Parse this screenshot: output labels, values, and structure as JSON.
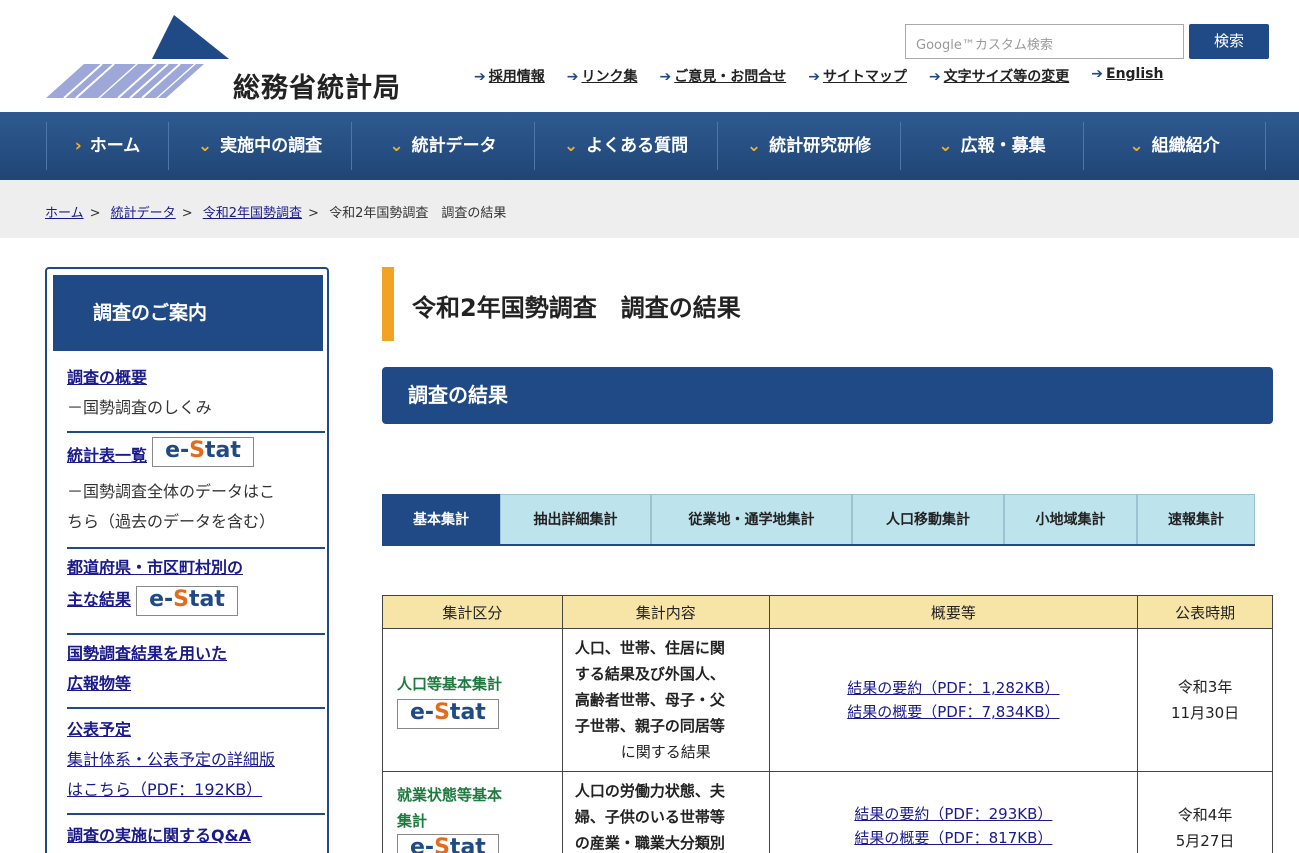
{
  "header": {
    "site_title": "総務省統計局",
    "search_placeholder": "Google™カスタム検索",
    "search_button": "検索",
    "util_links": [
      {
        "label": "採用情報"
      },
      {
        "label": "リンク集"
      },
      {
        "label": "ご意見・お問合せ"
      },
      {
        "label": "サイトマップ"
      },
      {
        "label": "文字サイズ等の変更"
      },
      {
        "label": "English"
      }
    ]
  },
  "gnav": {
    "items": [
      {
        "label": "ホーム"
      },
      {
        "label": "実施中の調査"
      },
      {
        "label": "統計データ"
      },
      {
        "label": "よくある質問"
      },
      {
        "label": "統計研究研修"
      },
      {
        "label": "広報・募集"
      },
      {
        "label": "組織紹介"
      }
    ]
  },
  "breadcrumb": {
    "items": [
      "ホーム",
      "統計データ",
      "令和2年国勢調査"
    ],
    "current": "令和2年国勢調査　調査の結果"
  },
  "sidebar": {
    "heading": "調査のご案内",
    "items": [
      {
        "title": "調査の概要",
        "desc": "－国勢調査のしくみ"
      },
      {
        "title": "統計表一覧",
        "desc1": "－国勢調査全体のデータはこ",
        "desc2": "ちら（過去のデータを含む）"
      },
      {
        "title1": "都道府県・市区町村別の",
        "title2": "主な結果"
      },
      {
        "title1": "国勢調査結果を用いた",
        "title2": "広報物等"
      },
      {
        "title": "公表予定",
        "desc1": "集計体系・公表予定の詳細版",
        "desc2": "はこちら（PDF：192KB）"
      },
      {
        "title": "調査の実施に関するQ&A"
      }
    ],
    "estat_prefix": "e-",
    "estat_suffix": "tat",
    "estat_s": "S"
  },
  "main": {
    "page_title": "令和2年国勢調査　調査の結果",
    "section_title": "調査の結果",
    "tabs": [
      {
        "label": "基本集計"
      },
      {
        "label": "抽出詳細集計"
      },
      {
        "label": "従業地・通学地集計"
      },
      {
        "label": "人口移動集計"
      },
      {
        "label": "小地域集計"
      },
      {
        "label": "速報集計"
      }
    ],
    "table": {
      "headers": [
        "集計区分",
        "集計内容",
        "概要等",
        "公表時期"
      ],
      "rows": [
        {
          "category": "人口等基本集計",
          "content_bold": [
            "人口、世帯、住居に関",
            "する結果及び外国人、",
            "高齢者世帯、母子・父",
            "子世帯、親子の同居等"
          ],
          "content_plain": "に関する結果",
          "links": [
            "結果の要約（PDF：1,282KB）",
            "結果の概要（PDF：7,834KB）"
          ],
          "date1": "令和3年",
          "date2": "11月30日"
        },
        {
          "category1": "就業状態等基本",
          "category2": "集計",
          "content_bold": [
            "人口の労働力状態、夫",
            "婦、子供のいる世帯等",
            "の産業・職業大分類別"
          ],
          "links": [
            "結果の要約（PDF：293KB）",
            "結果の概要（PDF：817KB）"
          ],
          "date1": "令和4年",
          "date2": "5月27日"
        }
      ]
    }
  },
  "colors": {
    "brand_navy": "#1f4a86",
    "accent_orange": "#f2a323",
    "tab_light": "#bde3ed",
    "table_header": "#f7e5a8",
    "category_green": "#1e7a3e"
  }
}
